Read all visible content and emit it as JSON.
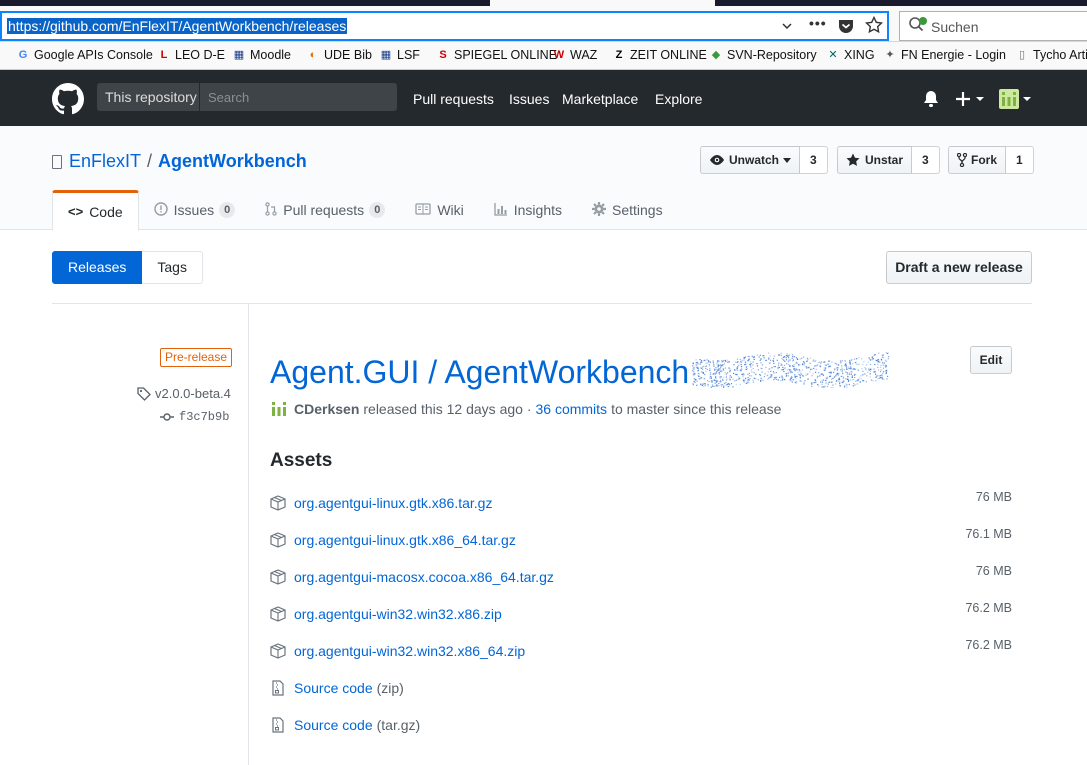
{
  "browser": {
    "url": "https://github.com/EnFlexIT/AgentWorkbench/releases",
    "search_placeholder": "Suchen",
    "bookmarks": [
      {
        "label": "Google APIs Console",
        "icon": "google-icon",
        "color": "#4285f4"
      },
      {
        "label": "LEO D-E",
        "icon": "leo-icon",
        "color": "#c00"
      },
      {
        "label": "Moodle",
        "icon": "moodle-icon",
        "color": "#1a3d8f"
      },
      {
        "label": "UDE Bib",
        "icon": "ude-bib-icon",
        "color": "#e07000"
      },
      {
        "label": "LSF",
        "icon": "lsf-icon",
        "color": "#1a3d8f"
      },
      {
        "label": "SPIEGEL ONLINE",
        "icon": "spiegel-icon",
        "color": "#c00"
      },
      {
        "label": "WAZ",
        "icon": "waz-icon",
        "color": "#c00"
      },
      {
        "label": "ZEIT ONLINE",
        "icon": "zeit-icon",
        "color": "#000"
      },
      {
        "label": "SVN-Repository",
        "icon": "svn-icon",
        "color": "#3a9a3a"
      },
      {
        "label": "XING",
        "icon": "xing-icon",
        "color": "#026466"
      },
      {
        "label": "FN Energie - Login",
        "icon": "fn-icon",
        "color": "#555"
      },
      {
        "label": "Tycho Arti",
        "icon": "page-icon",
        "color": "#777"
      }
    ]
  },
  "header": {
    "scope_label": "This repository",
    "search_placeholder": "Search",
    "nav": [
      "Pull requests",
      "Issues",
      "Marketplace",
      "Explore"
    ]
  },
  "repo": {
    "owner": "EnFlexIT",
    "separator": "/",
    "name": "AgentWorkbench",
    "watch_label": "Unwatch",
    "watch_count": "3",
    "star_label": "Unstar",
    "star_count": "3",
    "fork_label": "Fork",
    "fork_count": "1",
    "tabs": [
      {
        "label": "Code",
        "counter": null
      },
      {
        "label": "Issues",
        "counter": "0"
      },
      {
        "label": "Pull requests",
        "counter": "0"
      },
      {
        "label": "Wiki",
        "counter": null
      },
      {
        "label": "Insights",
        "counter": null
      },
      {
        "label": "Settings",
        "counter": null
      }
    ]
  },
  "subnav": {
    "releases": "Releases",
    "tags": "Tags",
    "draft_button": "Draft a new release"
  },
  "release": {
    "badge": "Pre-release",
    "tag": "v2.0.0-beta.4",
    "commit": "f3c7b9b",
    "title": "Agent.GUI / AgentWorkbench",
    "edit": "Edit",
    "author": "CDerksen",
    "released_text": "released this 12 days ago ·",
    "commits_link": "36 commits",
    "commits_suffix": "to master since this release",
    "assets_heading": "Assets",
    "assets": [
      {
        "name": "org.agentgui-linux.gtk.x86.tar.gz",
        "size": "76 MB"
      },
      {
        "name": "org.agentgui-linux.gtk.x86_64.tar.gz",
        "size": "76.1 MB"
      },
      {
        "name": "org.agentgui-macosx.cocoa.x86_64.tar.gz",
        "size": "76 MB"
      },
      {
        "name": "org.agentgui-win32.win32.x86.zip",
        "size": "76.2 MB"
      },
      {
        "name": "org.agentgui-win32.win32.x86_64.zip",
        "size": "76.2 MB"
      }
    ],
    "source": [
      {
        "name": "Source code",
        "format": "(zip)"
      },
      {
        "name": "Source code",
        "format": "(tar.gz)"
      }
    ]
  },
  "colors": {
    "link": "#0366d6",
    "header_bg": "#24292e",
    "prerelease": "#e36209",
    "selected_tab": "#0366d6"
  }
}
